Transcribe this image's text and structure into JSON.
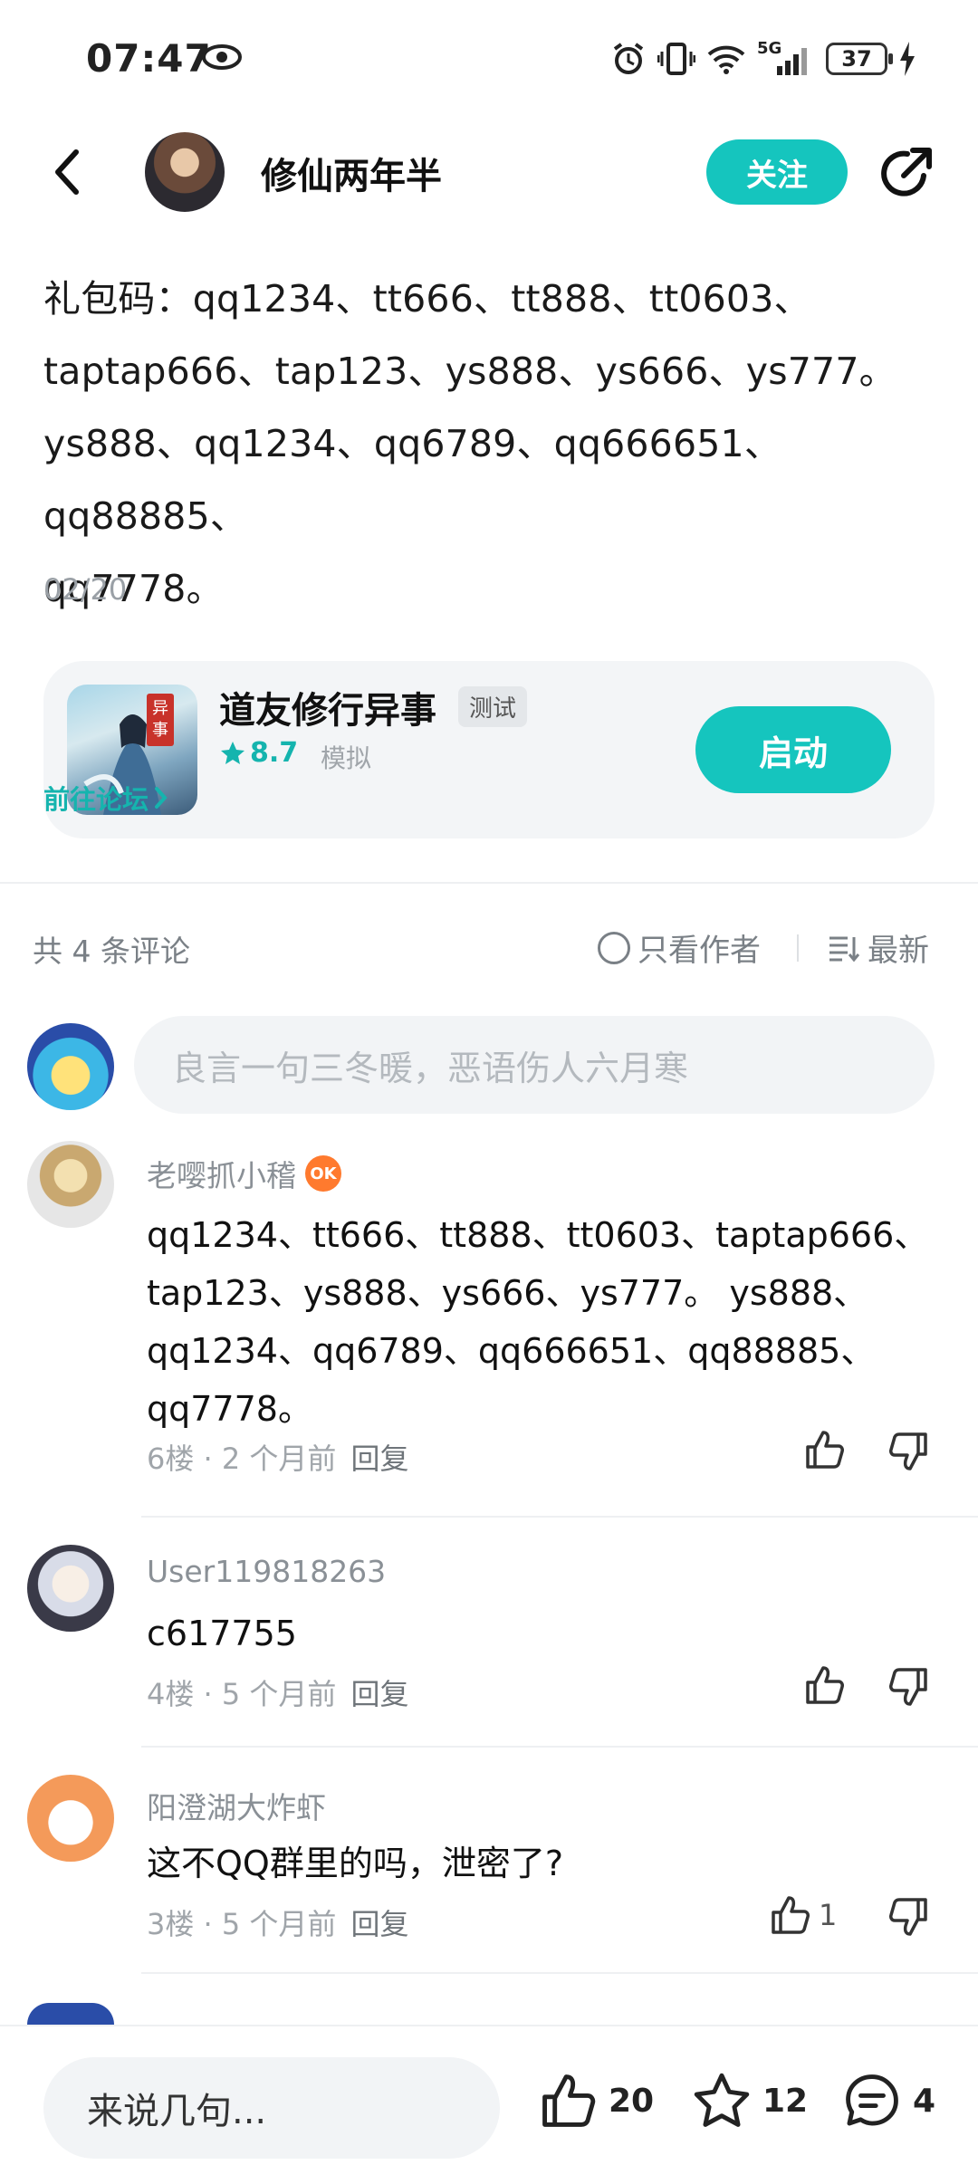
{
  "status_bar": {
    "time": "07:47",
    "network": "5G",
    "battery": "37",
    "icons": [
      "eye-icon",
      "alarm-icon",
      "vibrate-icon",
      "wifi-icon",
      "signal-icon",
      "battery-icon",
      "charging-icon"
    ]
  },
  "header": {
    "author_name": "修仙两年半",
    "follow_label": "关注",
    "icons": [
      "back-icon",
      "share-icon"
    ]
  },
  "post": {
    "lines": [
      "礼包码：qq1234、tt666、tt888、tt0603、",
      "taptap666、tap123、ys888、ys666、ys777。",
      "ys888、qq1234、qq6789、qq666651、qq88885、",
      "qq7778。"
    ],
    "date": "02/20"
  },
  "game_card": {
    "title": "道友修行异事",
    "tag": "测试",
    "rating": "8.7",
    "genre": "模拟",
    "forum_link": "前往论坛",
    "launch_label": "启动",
    "icon_seal": "异事"
  },
  "comments_header": {
    "count_label": "共 4 条评论",
    "author_only_label": "只看作者",
    "sort_label": "最新"
  },
  "comment_input": {
    "placeholder": "良言一句三冬暖，恶语伤人六月寒"
  },
  "comments": [
    {
      "user": "老嘤抓小稽",
      "text_lines": [
        "qq1234、tt666、tt888、tt0603、taptap666、",
        "tap123、ys888、ys666、ys777。 ys888、",
        "qq1234、qq6789、qq666651、qq88885、",
        "qq7778。"
      ],
      "floor": "6楼",
      "time": "2 个月前",
      "reply_label": "回复",
      "likes": ""
    },
    {
      "user": "User119818263",
      "text_lines": [
        "c617755"
      ],
      "floor": "4楼",
      "time": "5 个月前",
      "reply_label": "回复",
      "likes": ""
    },
    {
      "user": "阳澄湖大炸虾",
      "text_lines": [
        "这不QQ群里的吗，泄密了?"
      ],
      "floor": "3楼",
      "time": "5 个月前",
      "reply_label": "回复",
      "likes": "1"
    }
  ],
  "bottom_bar": {
    "input_placeholder": "来说几句...",
    "like_count": "20",
    "favorite_count": "12",
    "comment_count": "4"
  },
  "colors": {
    "accent": "#15c5be",
    "text_primary": "#1a1a1a",
    "text_secondary": "#8a9096"
  }
}
